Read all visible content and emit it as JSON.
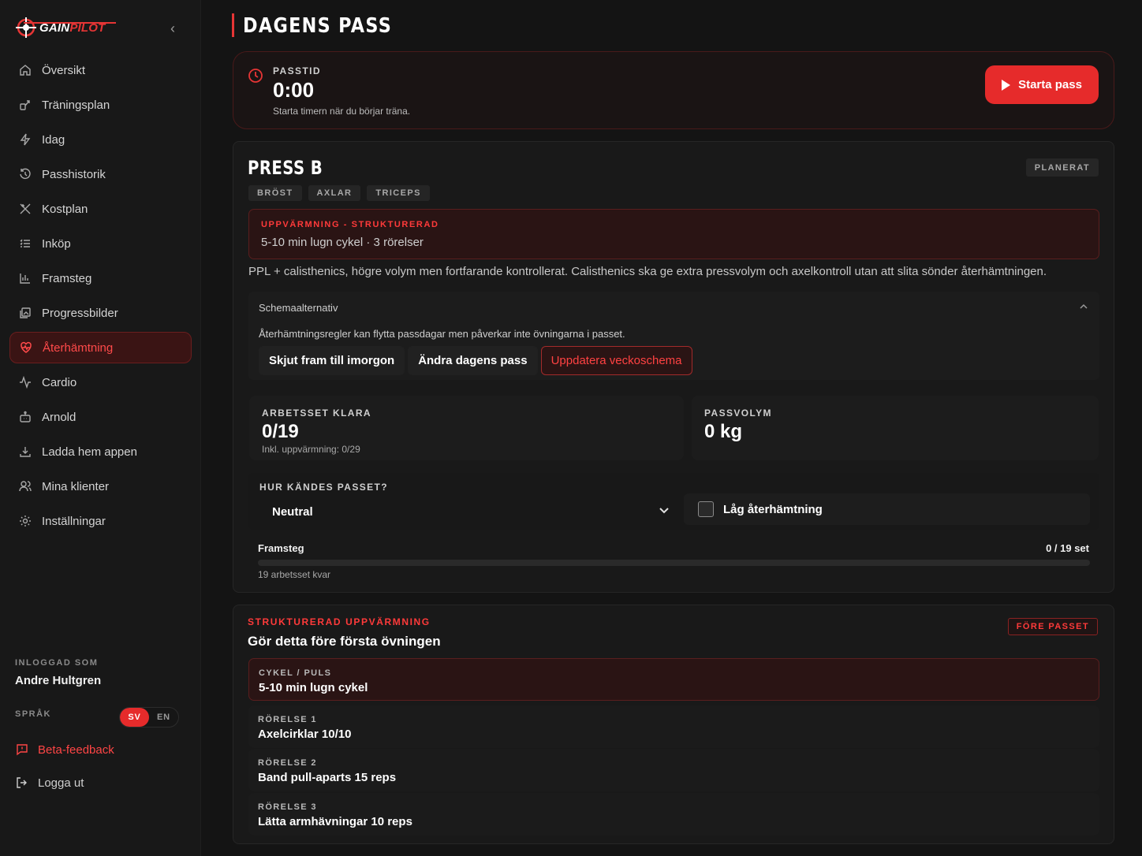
{
  "app": {
    "logo_part1": "GAIN",
    "logo_part2": "PILOT",
    "colors": {
      "accent": "#e62b2b",
      "background": "#141414",
      "sidebar": "#181818"
    }
  },
  "sidebar": {
    "items": [
      {
        "label": "Översikt",
        "icon": "home-icon"
      },
      {
        "label": "Träningsplan",
        "icon": "plan-icon"
      },
      {
        "label": "Idag",
        "icon": "bolt-icon"
      },
      {
        "label": "Passhistorik",
        "icon": "history-icon"
      },
      {
        "label": "Kostplan",
        "icon": "utensils-icon"
      },
      {
        "label": "Inköp",
        "icon": "list-icon"
      },
      {
        "label": "Framsteg",
        "icon": "bar-chart-icon"
      },
      {
        "label": "Progressbilder",
        "icon": "gallery-icon"
      },
      {
        "label": "Återhämtning",
        "icon": "heart-pulse-icon",
        "active": true
      },
      {
        "label": "Cardio",
        "icon": "activity-icon"
      },
      {
        "label": "Arnold",
        "icon": "bot-icon"
      },
      {
        "label": "Ladda hem appen",
        "icon": "download-icon"
      },
      {
        "label": "Mina klienter",
        "icon": "users-icon"
      },
      {
        "label": "Inställningar",
        "icon": "gear-icon"
      }
    ],
    "logged_in_label": "INLOGGAD SOM",
    "user_name": "Andre Hultgren",
    "language_label": "SPRÅK",
    "lang_sv": "SV",
    "lang_en": "EN",
    "beta_feedback": "Beta-feedback",
    "logout": "Logga ut"
  },
  "page": {
    "title": "DAGENS PASS"
  },
  "timer": {
    "label": "PASSTID",
    "value": "0:00",
    "hint": "Starta timern när du börjar träna.",
    "start_button": "Starta pass"
  },
  "session": {
    "title": "PRESS B",
    "status": "PLANERAT",
    "tags": [
      "BRÖST",
      "AXLAR",
      "TRICEPS"
    ],
    "warmup_title": "UPPVÄRMNING - STRUKTURERAD",
    "warmup_summary": "5-10 min lugn cykel · 3 rörelser",
    "description": "PPL + calisthenics, högre volym men fortfarande kontrollerat. Calisthenics ska ge extra pressvolym och axelkontroll utan att slita sönder återhämtningen.",
    "schedule": {
      "title": "Schemaalternativ",
      "hint": "Återhämtningsregler kan flytta passdagar men påverkar inte övningarna i passet.",
      "btn_postpone": "Skjut fram till imorgon",
      "btn_change": "Ändra dagens pass",
      "btn_update": "Uppdatera veckoschema"
    },
    "stats": {
      "sets_label": "ARBETSSET KLARA",
      "sets_value": "0/19",
      "sets_sub": "Inkl. uppvärmning: 0/29",
      "volume_label": "PASSVOLYM",
      "volume_value": "0 kg"
    },
    "feel": {
      "label": "HUR KÄNDES PASSET?",
      "selected": "Neutral",
      "low_recovery": "Låg återhämtning"
    },
    "progress": {
      "label": "Framsteg",
      "count": "0 / 19 set",
      "fraction": 0,
      "remaining": "19 arbetsset kvar"
    }
  },
  "warmup": {
    "kicker": "STRUKTURERAD UPPVÄRMNING",
    "title": "Gör detta före första övningen",
    "badge": "FÖRE PASSET",
    "items": [
      {
        "key": "CYKEL / PULS",
        "value": "5-10 min lugn cykel"
      },
      {
        "key": "RÖRELSE 1",
        "value": "Axelcirklar 10/10"
      },
      {
        "key": "RÖRELSE 2",
        "value": "Band pull-aparts 15 reps"
      },
      {
        "key": "RÖRELSE 3",
        "value": "Lätta armhävningar 10 reps"
      }
    ]
  }
}
